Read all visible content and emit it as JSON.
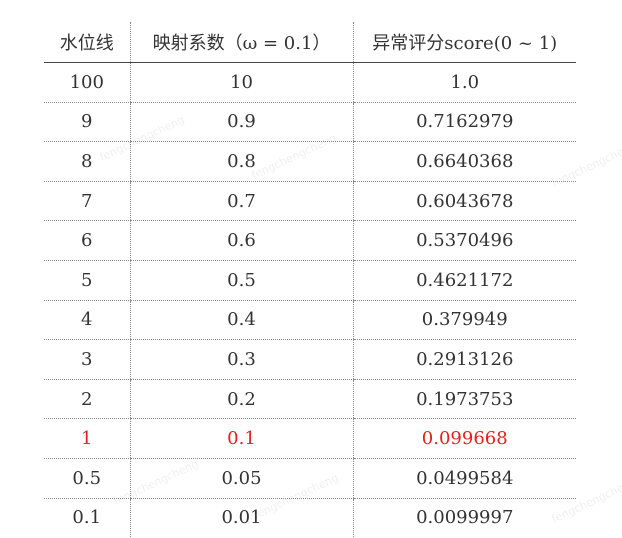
{
  "header": {
    "col1": "水位线",
    "col2": "映射系数（ω = 0.1）",
    "col3": "异常评分score(0 ~ 1)"
  },
  "rows": [
    {
      "level": "100",
      "coef": "10",
      "score": "1.0",
      "highlight": false
    },
    {
      "level": "9",
      "coef": "0.9",
      "score": "0.7162979",
      "highlight": false
    },
    {
      "level": "8",
      "coef": "0.8",
      "score": "0.6640368",
      "highlight": false
    },
    {
      "level": "7",
      "coef": "0.7",
      "score": "0.6043678",
      "highlight": false
    },
    {
      "level": "6",
      "coef": "0.6",
      "score": "0.5370496",
      "highlight": false
    },
    {
      "level": "5",
      "coef": "0.5",
      "score": "0.4621172",
      "highlight": false
    },
    {
      "level": "4",
      "coef": "0.4",
      "score": "0.379949",
      "highlight": false
    },
    {
      "level": "3",
      "coef": "0.3",
      "score": "0.2913126",
      "highlight": false
    },
    {
      "level": "2",
      "coef": "0.2",
      "score": "0.1973753",
      "highlight": false
    },
    {
      "level": "1",
      "coef": "0.1",
      "score": "0.099668",
      "highlight": true
    },
    {
      "level": "0.5",
      "coef": "0.05",
      "score": "0.0499584",
      "highlight": false
    },
    {
      "level": "0.1",
      "coef": "0.01",
      "score": "0.0099997",
      "highlight": false
    }
  ],
  "watermark": "fengchengcheng",
  "colors": {
    "text": "#333333",
    "highlight": "#e0221e",
    "rule": "#444444",
    "dotted": "#8a8a8a"
  }
}
